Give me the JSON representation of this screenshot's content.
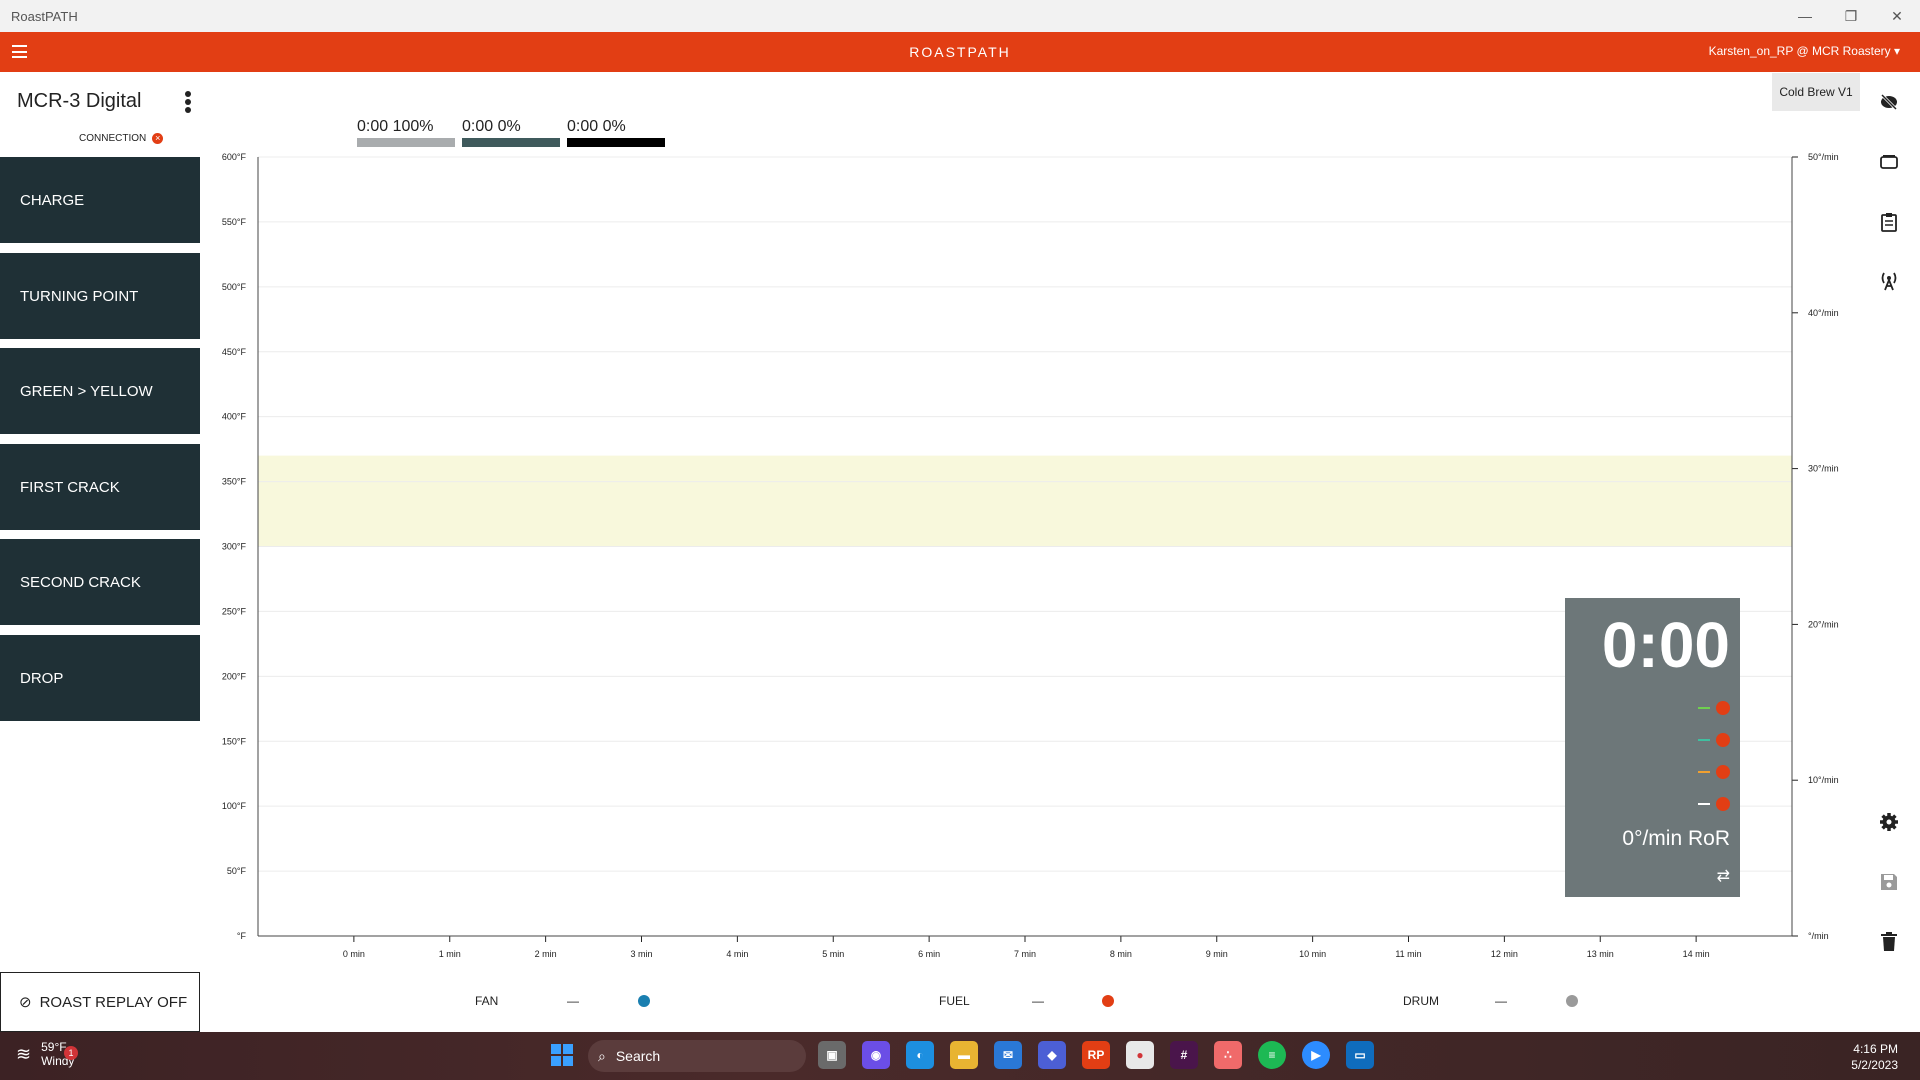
{
  "window": {
    "title": "RoastPATH",
    "minimize": "—",
    "maximize": "❐",
    "close": "✕"
  },
  "appbar": {
    "brand": "ROASTPATH",
    "user": "Karsten_on_RP @ MCR Roastery ▾"
  },
  "sidebar": {
    "machine_name": "MCR-3 Digital",
    "connection_label": "CONNECTION",
    "events": [
      "CHARGE",
      "TURNING POINT",
      "GREEN > YELLOW",
      "FIRST CRACK",
      "SECOND CRACK",
      "DROP"
    ]
  },
  "legend": [
    {
      "time": "0:00",
      "pct": "100%",
      "color": "#a9acae"
    },
    {
      "time": "0:00",
      "pct": "0%",
      "color": "#3f5a5c"
    },
    {
      "time": "0:00",
      "pct": "0%",
      "color": "#000000"
    }
  ],
  "profile_tab": "Cold Brew V1",
  "chart_data": {
    "type": "line",
    "x_ticks": [
      "0 min",
      "1 min",
      "2 min",
      "3 min",
      "4 min",
      "5 min",
      "6 min",
      "7 min",
      "8 min",
      "9 min",
      "10 min",
      "11 min",
      "12 min",
      "13 min",
      "14 min"
    ],
    "y_ticks": [
      "°F",
      "50°F",
      "100°F",
      "150°F",
      "200°F",
      "250°F",
      "300°F",
      "350°F",
      "400°F",
      "450°F",
      "500°F",
      "550°F",
      "600°F"
    ],
    "y2_ticks": [
      "°/min",
      "10°/min",
      "20°/min",
      "30°/min",
      "40°/min",
      "50°/min"
    ],
    "ylim": [
      0,
      600
    ],
    "y2lim": [
      0,
      50
    ],
    "xlim": [
      -1,
      15
    ],
    "band": {
      "from": 300,
      "to": 370,
      "color": "#f8f8dc"
    },
    "grid": true,
    "series": []
  },
  "overlay": {
    "time": "0:00",
    "rows": [
      {
        "dash": "—",
        "color": "#6fcf4f"
      },
      {
        "dash": "—",
        "color": "#3fbfa0"
      },
      {
        "dash": "—",
        "color": "#f0a030"
      },
      {
        "dash": "—",
        "color": "#ffffff"
      }
    ],
    "ror": "0°/min RoR",
    "swap_icon": "⇄"
  },
  "rail_icons": [
    "no-view-icon",
    "screen-icon",
    "notes-icon",
    "broadcast-icon",
    "gear-icon",
    "save-icon",
    "trash-icon"
  ],
  "footer": {
    "replay": "ROAST REPLAY OFF",
    "controls": [
      {
        "label": "FAN",
        "value": "—",
        "color": "#1a7fb0"
      },
      {
        "label": "FUEL",
        "value": "—",
        "color": "#e23e14"
      },
      {
        "label": "DRUM",
        "value": "—",
        "color": "#9a9a9a"
      }
    ]
  },
  "taskbar": {
    "temp": "59°F",
    "weather": "Windy",
    "badge": "1",
    "search": "Search",
    "rp_label": "RP",
    "time": "4:16 PM",
    "date": "5/2/2023"
  }
}
